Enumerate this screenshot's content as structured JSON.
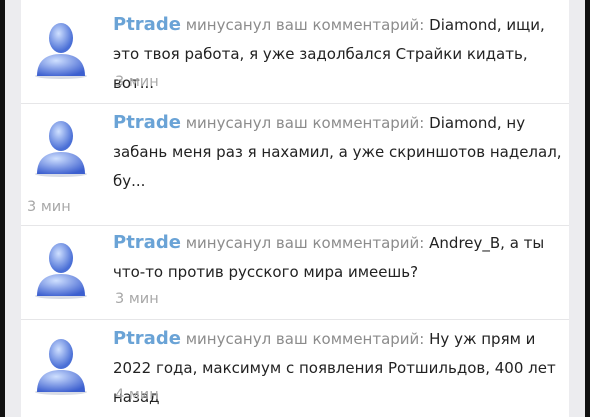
{
  "notifications": [
    {
      "user": "Ptrade",
      "action": "минусанул ваш комментарий:",
      "comment": "Diamond, ищи, это твоя работа, я уже задолбался Страйки кидать, вот...",
      "time": "3 мин"
    },
    {
      "user": "Ptrade",
      "action": "минусанул ваш комментарий:",
      "comment": "Diamond, ну забань меня раз я нахамил, а уже скриншотов наделал, бу...",
      "time": "3 мин"
    },
    {
      "user": "Ptrade",
      "action": "минусанул ваш комментарий:",
      "comment": "Andrey_B, а ты что-то против русского мира имеешь?",
      "time": "3 мин"
    },
    {
      "user": "Ptrade",
      "action": "минусанул ваш комментарий:",
      "comment": "Ну уж прям и 2022 года, максимум с появления Ротшильдов, 400 лет назад",
      "time": "4 мин"
    }
  ]
}
